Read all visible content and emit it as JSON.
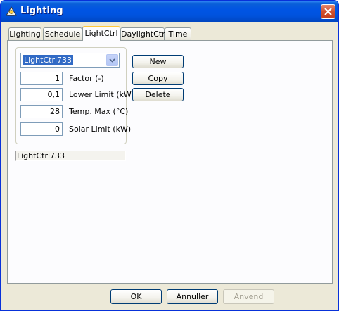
{
  "window": {
    "title": "Lighting",
    "app_icon": "lighting-app-icon",
    "close_icon": "close-icon"
  },
  "tabs": [
    {
      "label": "Lighting",
      "active": false
    },
    {
      "label": "Schedule",
      "active": false
    },
    {
      "label": "LightCtrl",
      "active": true
    },
    {
      "label": "DaylightCtrl",
      "active": false
    },
    {
      "label": "Time",
      "active": false
    }
  ],
  "panel": {
    "selector_value": "LightCtrl733",
    "fields": [
      {
        "value": "1",
        "label": "Factor (-)"
      },
      {
        "value": "0,1",
        "label": "Lower Limit (kW)"
      },
      {
        "value": "28",
        "label": "Temp. Max (°C)"
      },
      {
        "value": "0",
        "label": "Solar Limit (kW)"
      }
    ],
    "buttons": {
      "new": "New",
      "copy": "Copy",
      "delete": "Delete"
    },
    "name_display": "LightCtrl733"
  },
  "footer": {
    "ok": "OK",
    "cancel": "Annuller",
    "apply": "Anvend"
  }
}
